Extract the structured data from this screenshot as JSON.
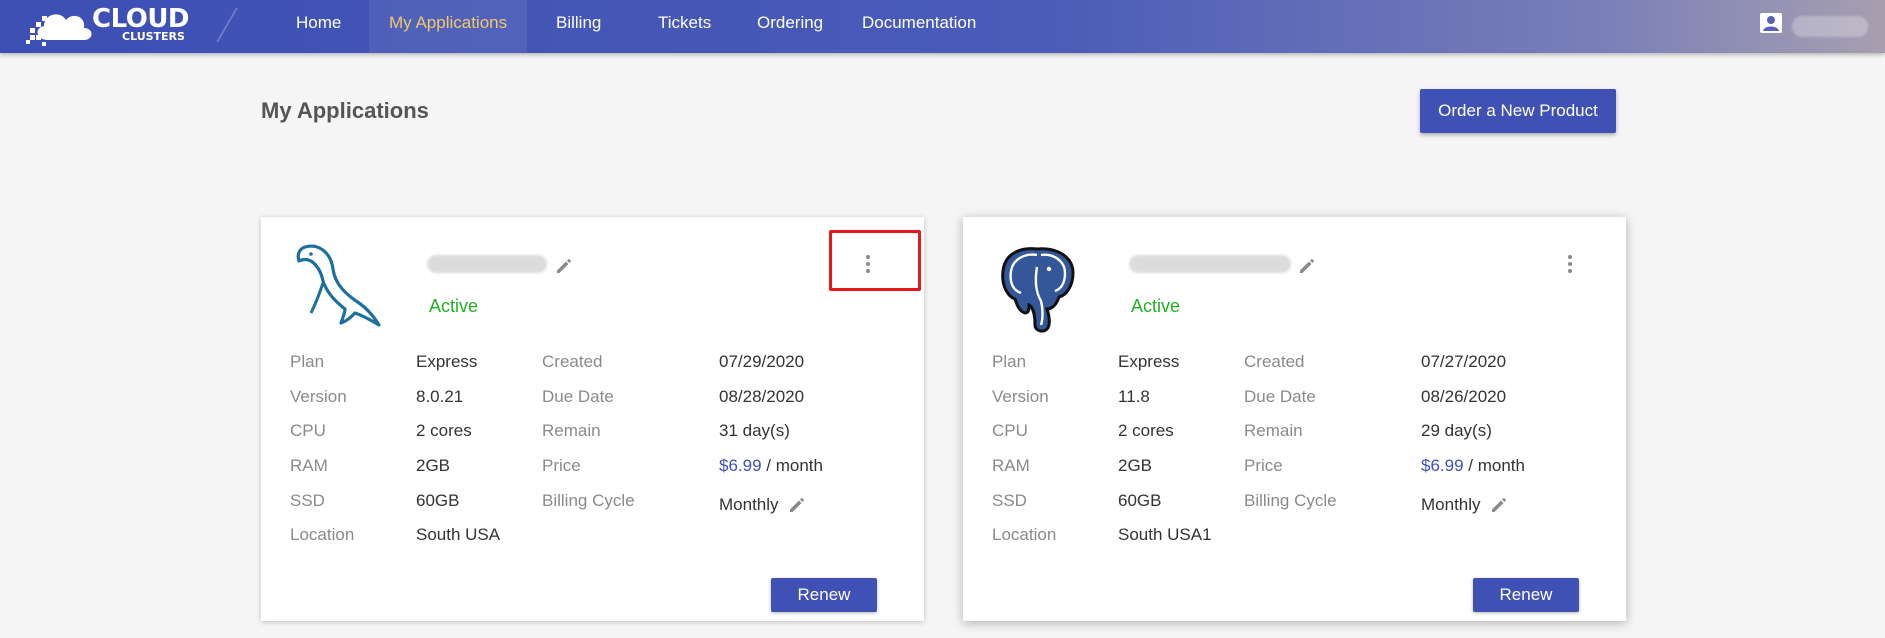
{
  "header": {
    "logo": {
      "main": "CLOUD",
      "sub": "CLUSTERS"
    },
    "nav": [
      "Home",
      "My Applications",
      "Billing",
      "Tickets",
      "Ordering",
      "Documentation"
    ],
    "active_nav": "My Applications",
    "user_icon": "account-box-icon"
  },
  "page": {
    "title": "My Applications",
    "order_button": "Order a New Product"
  },
  "labels": {
    "plan": "Plan",
    "version": "Version",
    "cpu": "CPU",
    "ram": "RAM",
    "ssd": "SSD",
    "location": "Location",
    "created": "Created",
    "due_date": "Due Date",
    "remain": "Remain",
    "price": "Price",
    "billing_cycle": "Billing Cycle"
  },
  "apps": [
    {
      "logo": "mysql-dolphin-icon",
      "status": "Active",
      "plan": "Express",
      "version": "8.0.21",
      "cpu": "2 cores",
      "ram": "2GB",
      "ssd": "60GB",
      "location": "South USA",
      "created": "07/29/2020",
      "due_date": "08/28/2020",
      "remain": "31 day(s)",
      "price_amount": "$6.99",
      "price_unit": "/ month",
      "billing_cycle": "Monthly",
      "renew": "Renew"
    },
    {
      "logo": "postgresql-elephant-icon",
      "status": "Active",
      "plan": "Express",
      "version": "11.8",
      "cpu": "2 cores",
      "ram": "2GB",
      "ssd": "60GB",
      "location": "South USA1",
      "created": "07/27/2020",
      "due_date": "08/26/2020",
      "remain": "29 day(s)",
      "price_amount": "$6.99",
      "price_unit": "/ month",
      "billing_cycle": "Monthly",
      "renew": "Renew"
    }
  ],
  "colors": {
    "primary": "#3f51b5",
    "active_nav": "#f0c96a",
    "status_active": "#22b022",
    "highlight": "#e8161b"
  }
}
